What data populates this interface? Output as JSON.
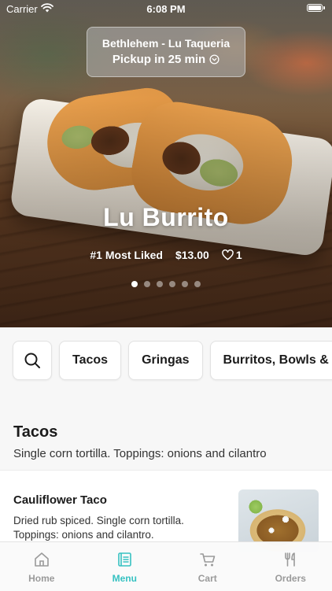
{
  "status_bar": {
    "carrier": "Carrier",
    "time": "6:08 PM",
    "icons": [
      "wifi-icon",
      "battery-icon"
    ]
  },
  "location": {
    "name": "Bethlehem - Lu Taqueria",
    "pickup": "Pickup in 25 min",
    "icon": "chevron-down-circle-icon"
  },
  "featured": {
    "title": "Lu Burrito",
    "tag": "#1 Most Liked",
    "price": "$13.00",
    "likes": "1",
    "carousel_total": 6,
    "carousel_active": 1
  },
  "categories": {
    "search_icon": "search-icon",
    "items": [
      "Tacos",
      "Gringas",
      "Burritos, Bowls &"
    ]
  },
  "section": {
    "title": "Tacos",
    "subtitle": "Single corn tortilla. Toppings: onions and cilantro"
  },
  "menu_item": {
    "name": "Cauliflower Taco",
    "description": "Dried rub spiced. Single corn tortilla. Toppings: onions and cilantro."
  },
  "tabbar": {
    "accent": "#35c1c1",
    "inactive": "#9a9a9a",
    "tabs": [
      {
        "label": "Home",
        "icon": "home-icon"
      },
      {
        "label": "Menu",
        "icon": "menu-book-icon",
        "active": true
      },
      {
        "label": "Cart",
        "icon": "cart-icon"
      },
      {
        "label": "Orders",
        "icon": "fork-knife-icon"
      }
    ]
  }
}
